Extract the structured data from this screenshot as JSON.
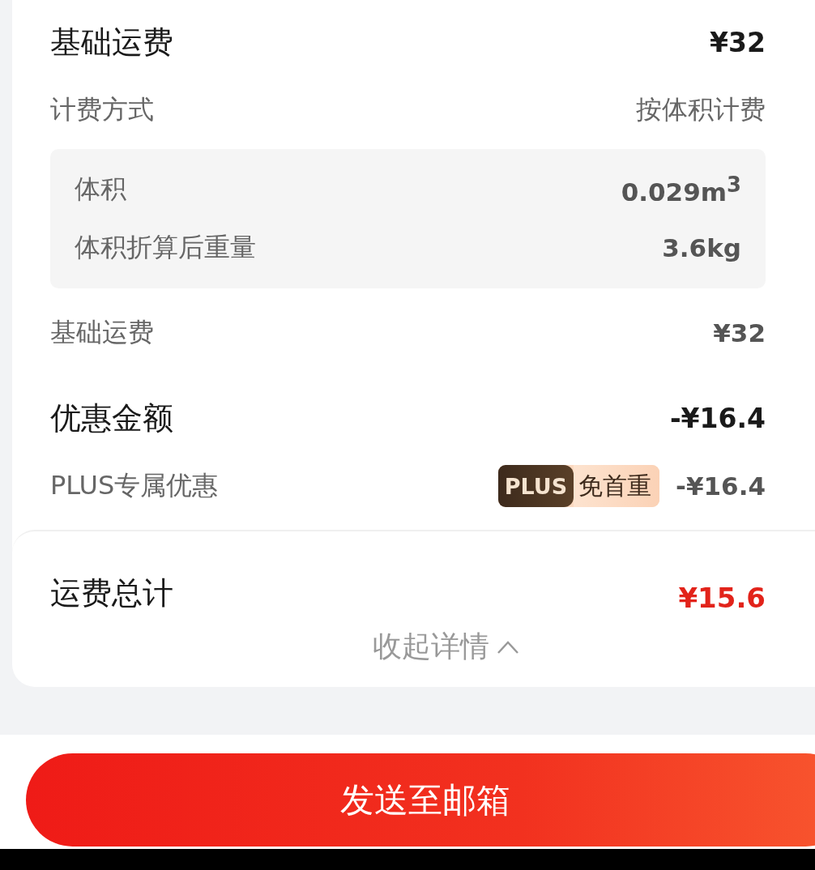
{
  "base_fee": {
    "label": "基础运费",
    "value": "¥32"
  },
  "billing": {
    "label": "计费方式",
    "value": "按体积计费"
  },
  "details": [
    {
      "label": "体积",
      "value": "0.029m$^{3}$"
    },
    {
      "label": "体积折算后重量",
      "value": "3.6kg"
    }
  ],
  "base_fee_line": {
    "label": "基础运费",
    "value": "¥32"
  },
  "discount": {
    "label": "优惠金额",
    "value": "-¥16.4"
  },
  "discount_items": [
    {
      "label": "PLUS专属优惠",
      "badge_brand": "PLUS",
      "badge_text": "免首重",
      "value": "-¥16.4"
    }
  ],
  "total": {
    "label": "运费总计",
    "value": "¥15.6"
  },
  "collapse_toggle": {
    "label": "收起详情",
    "expanded": true
  },
  "send_button": {
    "label": "发送至邮箱"
  }
}
